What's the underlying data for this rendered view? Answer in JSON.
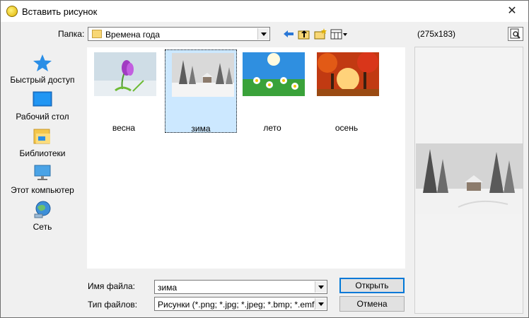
{
  "window": {
    "title": "Вставить рисунок"
  },
  "folder": {
    "label": "Папка:",
    "value": "Времена года"
  },
  "preview": {
    "size_label": "(275x183)"
  },
  "places": [
    {
      "label": "Быстрый доступ",
      "icon": "star-icon"
    },
    {
      "label": "Рабочий стол",
      "icon": "desktop-icon"
    },
    {
      "label": "Библиотеки",
      "icon": "libraries-icon"
    },
    {
      "label": "Этот компьютер",
      "icon": "computer-icon"
    },
    {
      "label": "Сеть",
      "icon": "network-icon"
    }
  ],
  "files": [
    {
      "name": "весна"
    },
    {
      "name": "зима",
      "selected": true
    },
    {
      "name": "лето"
    },
    {
      "name": "осень"
    }
  ],
  "filename": {
    "label": "Имя файла:",
    "value": "зима"
  },
  "filetype": {
    "label": "Тип файлов:",
    "value": "Рисунки (*.png; *.jpg; *.jpeg; *.bmp; *.emf)"
  },
  "buttons": {
    "open": "Открыть",
    "cancel": "Отмена"
  },
  "close_glyph": "✕",
  "colors": {
    "selection": "#cce8ff",
    "accent": "#0078d7"
  }
}
